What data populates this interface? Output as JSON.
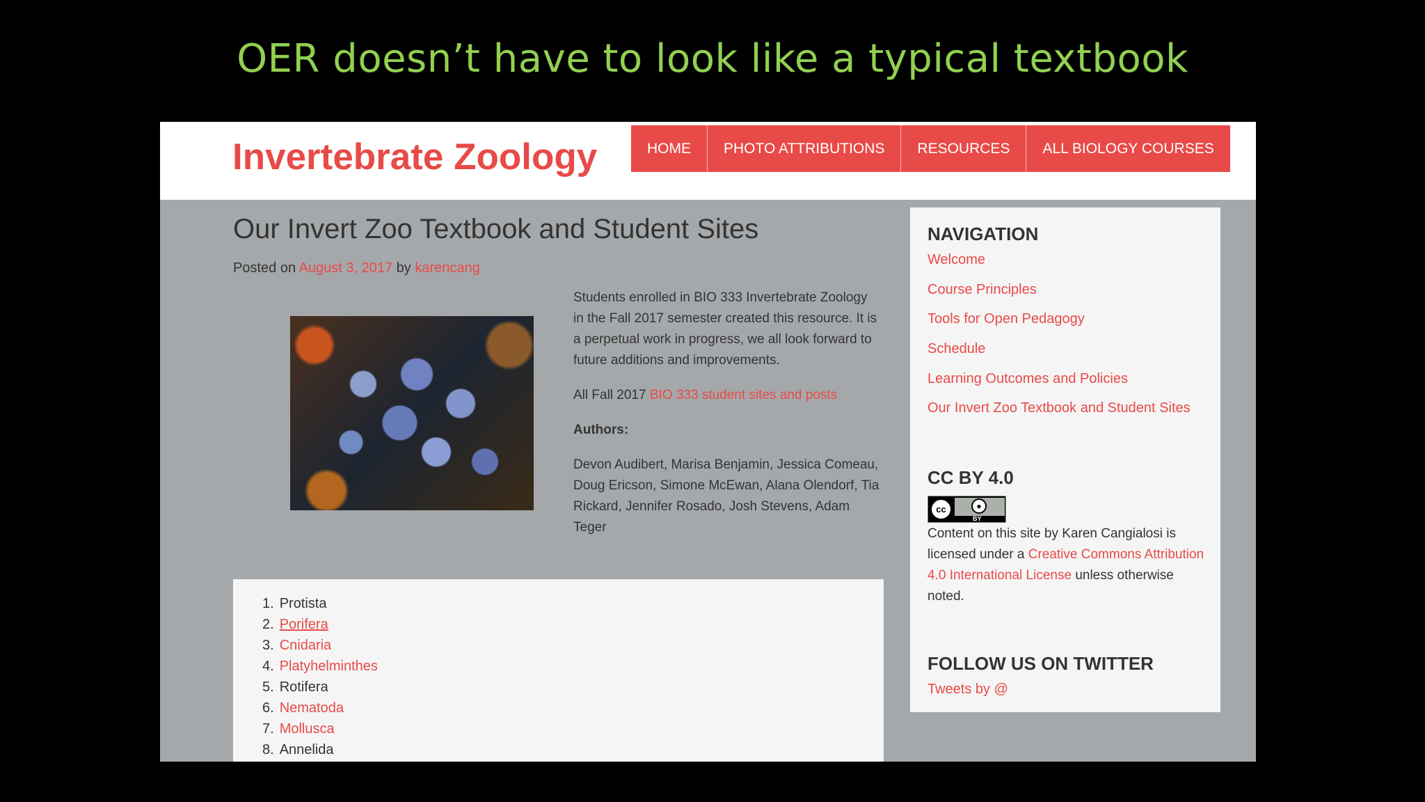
{
  "slide": {
    "title": "OER doesn’t have to look like a typical textbook"
  },
  "site": {
    "title": "Invertebrate Zoology",
    "nav": [
      "HOME",
      "PHOTO ATTRIBUTIONS",
      "RESOURCES",
      "ALL BIOLOGY COURSES"
    ]
  },
  "post": {
    "title": "Our Invert Zoo Textbook and Student Sites",
    "meta": {
      "prefix": "Posted on",
      "date": "August 3, 2017",
      "by": "by",
      "author": "karencang"
    },
    "intro": "Students enrolled in BIO 333 Invertebrate Zoology in the Fall 2017 semester created this resource. It is a perpetual work in progress, we all look forward to future additions and improvements.",
    "all_prefix": "All Fall 2017",
    "all_link": "BIO 333 student sites and posts",
    "authors_label": "Authors:",
    "authors": "Devon Audibert, Marisa Benjamin, Jessica Comeau, Doug Ericson, Simone McEwan, Alana Olendorf, Tia Rickard, Jennifer Rosado, Josh Stevens, Adam Teger",
    "list": [
      {
        "num": "1.",
        "label": "Protista",
        "link": false
      },
      {
        "num": "2.",
        "label": "Porifera",
        "link": true,
        "underline": true
      },
      {
        "num": "3.",
        "label": "Cnidaria",
        "link": true
      },
      {
        "num": "4.",
        "label": "Platyhelminthes",
        "link": true
      },
      {
        "num": "5.",
        "label": "Rotifera",
        "link": false
      },
      {
        "num": "6.",
        "label": "Nematoda",
        "link": true
      },
      {
        "num": "7.",
        "label": "Mollusca",
        "link": true
      },
      {
        "num": "8.",
        "label": "Annelida",
        "link": false
      }
    ]
  },
  "sidebar": {
    "navigation": {
      "title": "NAVIGATION",
      "links": [
        "Welcome",
        "Course Principles",
        "Tools for Open Pedagogy",
        "Schedule",
        "Learning Outcomes and Policies",
        "Our Invert Zoo Textbook and Student Sites"
      ]
    },
    "license": {
      "title": "CC BY 4.0",
      "badge_cc": "cc",
      "badge_by": "BY",
      "text_prefix": "Content on this site by Karen Cangialosi is licensed under a",
      "link": "Creative Commons Attribution 4.0 International License",
      "text_suffix": "unless otherwise noted."
    },
    "twitter": {
      "title": "FOLLOW US ON TWITTER",
      "link": "Tweets by @"
    }
  },
  "colors": {
    "accent": "#e84a47",
    "slide_title": "#92d050",
    "content_bg": "#a5a8ab",
    "panel_bg": "#f5f5f5"
  }
}
